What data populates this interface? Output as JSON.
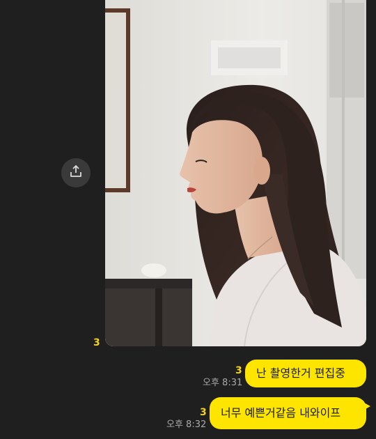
{
  "chat": {
    "photo_message": {
      "read_count": "3",
      "share_icon": "share-upload-icon"
    },
    "messages": [
      {
        "text": "난 촬영한거 편집중",
        "read_count": "3",
        "time": "오후 8:31"
      },
      {
        "text": "너무 예쁜거같음 내와이프",
        "read_count": "3",
        "time": "오후 8:32"
      }
    ]
  },
  "colors": {
    "background": "#1f1f1f",
    "bubble": "#fee500",
    "unread": "#f2d21c",
    "timestamp": "#a9a9a9"
  }
}
